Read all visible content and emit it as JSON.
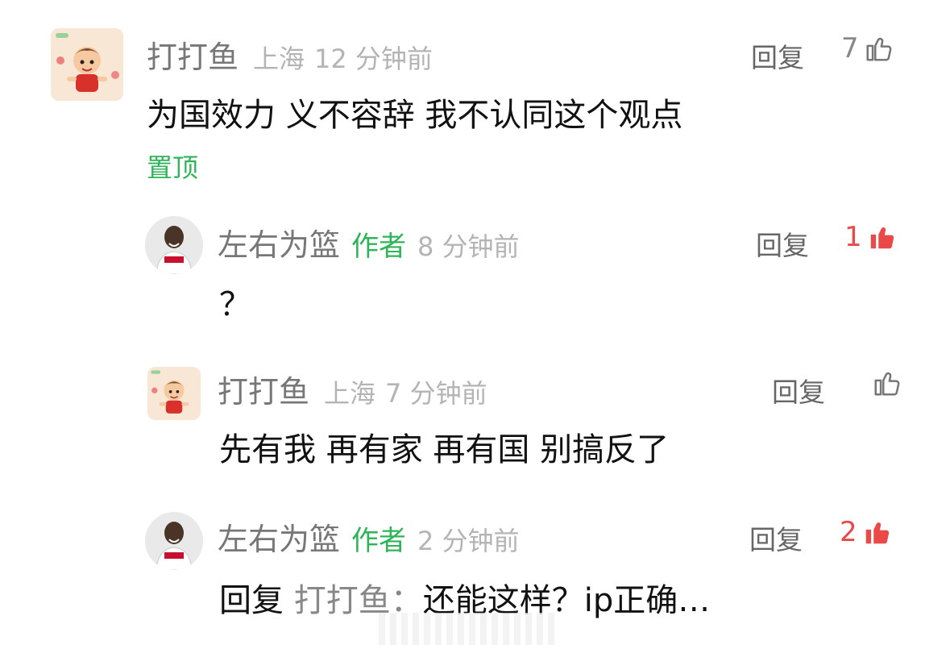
{
  "comments": [
    {
      "name": "打打鱼",
      "location": "上海",
      "time": "12 分钟前",
      "text": "为国效力 义不容辞  我不认同这个观点",
      "reply_label": "回复",
      "likes": "7",
      "liked": false,
      "pin_label": "置顶",
      "avatar": "cartoon-boy-avatar"
    },
    {
      "name": "左右为篮",
      "author_tag": "作者",
      "time": "8 分钟前",
      "text": "？",
      "reply_label": "回复",
      "likes": "1",
      "liked": true,
      "avatar": "basketball-player-avatar"
    },
    {
      "name": "打打鱼",
      "location": "上海",
      "time": "7 分钟前",
      "text": "先有我 再有家 再有国  别搞反了",
      "reply_label": "回复",
      "likes": "",
      "liked": false,
      "avatar": "cartoon-boy-avatar"
    },
    {
      "name": "左右为篮",
      "author_tag": "作者",
      "time": "2 分钟前",
      "reply_prefix": "回复",
      "reply_to": "打打鱼：",
      "text": "还能这样？ip正确…",
      "reply_label": "回复",
      "likes": "2",
      "liked": true,
      "avatar": "basketball-player-avatar"
    }
  ],
  "colors": {
    "author_green": "#2fb45a",
    "like_red": "#ea4a47",
    "muted": "#b4b4b4"
  }
}
